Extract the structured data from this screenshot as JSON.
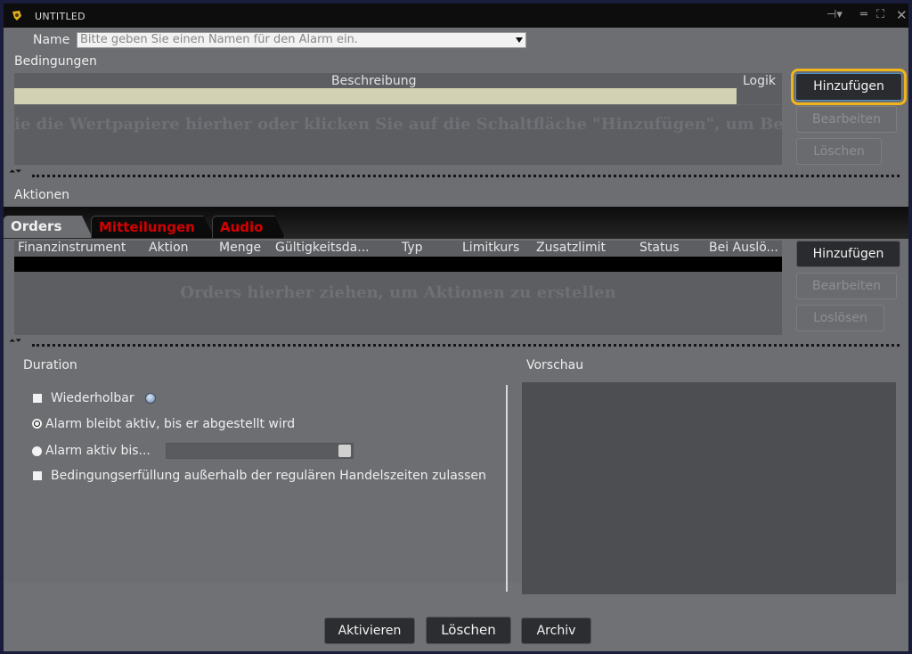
{
  "window": {
    "title": "UNTITLED",
    "controls": [
      "pin-icon",
      "minimize-icon",
      "maximize-icon",
      "close-icon"
    ]
  },
  "name_field": {
    "label": "Name",
    "placeholder": "Bitte geben Sie einen Namen für den Alarm ein."
  },
  "conditions": {
    "label": "Bedingungen",
    "col_description": "Beschreibung",
    "col_logic": "Logik",
    "hint": "ie die Wertpapiere hierher oder klicken Sie auf die Schaltfläche \"Hinzufügen\", um Bedingungen zu e",
    "buttons": {
      "add": "Hinzufügen",
      "edit": "Bearbeiten",
      "delete": "Löschen"
    }
  },
  "actions": {
    "label": "Aktionen",
    "tabs": [
      "Orders",
      "Mitteilungen",
      "Audio"
    ],
    "columns": [
      "Finanzinstrument",
      "Aktion",
      "Menge",
      "Gültigkeitsda...",
      "Typ",
      "Limitkurs",
      "Zusatzlimit",
      "Status",
      "Bei Auslö..."
    ],
    "hint": "Orders hierher ziehen, um Aktionen zu erstellen",
    "buttons": {
      "add": "Hinzufügen",
      "edit": "Bearbeiten",
      "detach": "Loslösen"
    }
  },
  "duration": {
    "label": "Duration",
    "repeatable": "Wiederholbar",
    "option_until_off": "Alarm bleibt aktiv, bis er abgestellt wird",
    "option_until_date": "Alarm aktiv bis...",
    "outside_hours": "Bedingungserfüllung außerhalb der regulären Handelszeiten zulassen"
  },
  "preview": {
    "label": "Vorschau"
  },
  "footer": {
    "activate": "Aktivieren",
    "delete": "Löschen",
    "archive": "Archiv"
  },
  "colors": {
    "accent_focus": "#f1b51c",
    "tab_text_inactive": "#d40000",
    "panel_bg": "#6d6e72"
  }
}
